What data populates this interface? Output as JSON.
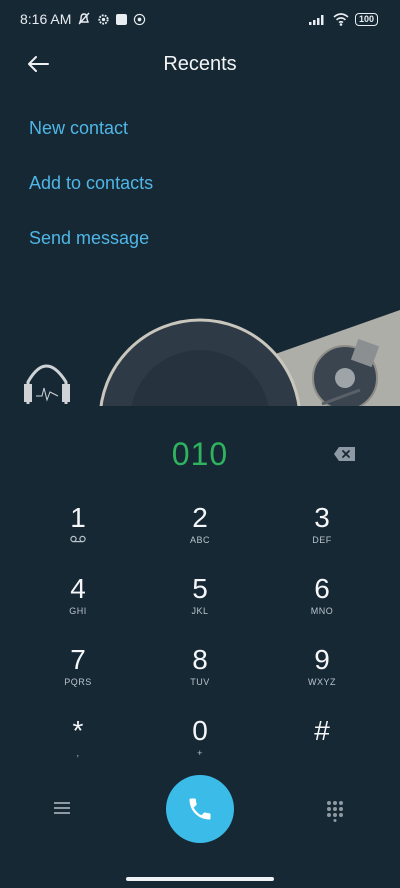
{
  "status_bar": {
    "time": "8:16 AM",
    "battery": "100"
  },
  "header": {
    "title": "Recents"
  },
  "menu": {
    "items": [
      {
        "label": "New contact"
      },
      {
        "label": "Add to contacts"
      },
      {
        "label": "Send message"
      }
    ]
  },
  "dialer": {
    "number": "010",
    "keys": [
      {
        "digit": "1",
        "letters": ""
      },
      {
        "digit": "2",
        "letters": "ABC"
      },
      {
        "digit": "3",
        "letters": "DEF"
      },
      {
        "digit": "4",
        "letters": "GHI"
      },
      {
        "digit": "5",
        "letters": "JKL"
      },
      {
        "digit": "6",
        "letters": "MNO"
      },
      {
        "digit": "7",
        "letters": "PQRS"
      },
      {
        "digit": "8",
        "letters": "TUV"
      },
      {
        "digit": "9",
        "letters": "WXYZ"
      },
      {
        "digit": "*",
        "letters": ","
      },
      {
        "digit": "0",
        "letters": "+"
      },
      {
        "digit": "#",
        "letters": ""
      }
    ]
  },
  "colors": {
    "background": "#172835",
    "accent": "#4fb6e6",
    "number": "#2fb35e",
    "call": "#3bbce8"
  },
  "icons": [
    "back-arrow-icon",
    "backspace-icon",
    "voicemail-icon",
    "menu-icon",
    "phone-icon",
    "dialpad-icon"
  ]
}
